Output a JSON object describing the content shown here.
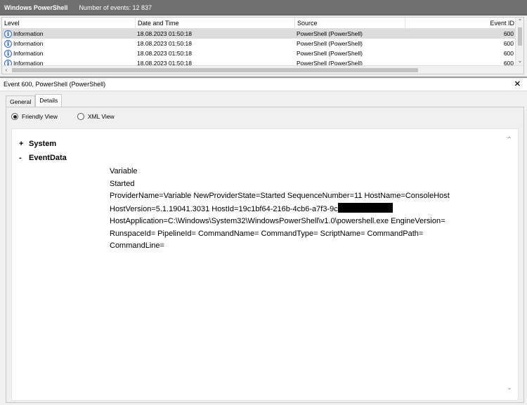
{
  "window": {
    "title": "Windows PowerShell",
    "event_count": "Number of events: 12 837"
  },
  "grid": {
    "columns": [
      "Level",
      "Date and Time",
      "Source",
      "Event ID"
    ],
    "rows": [
      {
        "level": "Information",
        "date": "18.08.2023 01:50:18",
        "source": "PowerShell (PowerShell)",
        "event_id": "600",
        "selected": true
      },
      {
        "level": "Information",
        "date": "18.08.2023 01:50:18",
        "source": "PowerShell (PowerShell)",
        "event_id": "600",
        "selected": false
      },
      {
        "level": "Information",
        "date": "18.08.2023 01:50:18",
        "source": "PowerShell (PowerShell)",
        "event_id": "600",
        "selected": false
      },
      {
        "level": "Information",
        "date": "18.08.2023 01:50:18",
        "source": "PowerShell (PowerShell)",
        "event_id": "600",
        "selected": false
      }
    ],
    "level_icon": "info-icon"
  },
  "detail": {
    "header": "Event 600, PowerShell (PowerShell)",
    "close_icon": "close-icon",
    "tabs": [
      "General",
      "Details"
    ],
    "active_tab": "Details",
    "view_options": [
      "Friendly View",
      "XML View"
    ],
    "selected_view": "Friendly View",
    "tree": {
      "system": {
        "toggle": "+",
        "label": "System"
      },
      "eventdata": {
        "toggle": "-",
        "label": "EventData"
      }
    },
    "data_lines": [
      "Variable",
      "Started",
      "ProviderName=Variable NewProviderState=Started SequenceNumber=11 HostName=ConsoleHost",
      "HostVersion=5.1.19041.3031 HostId=19c1bf64-216b-4cb6-a7f3-9c",
      "HostApplication=C:\\Windows\\System32\\WindowsPowerShell\\v1.0\\powershell.exe EngineVersion=",
      "RunspaceId= PipelineId= CommandName= CommandType= ScriptName= CommandPath=",
      "CommandLine="
    ]
  }
}
